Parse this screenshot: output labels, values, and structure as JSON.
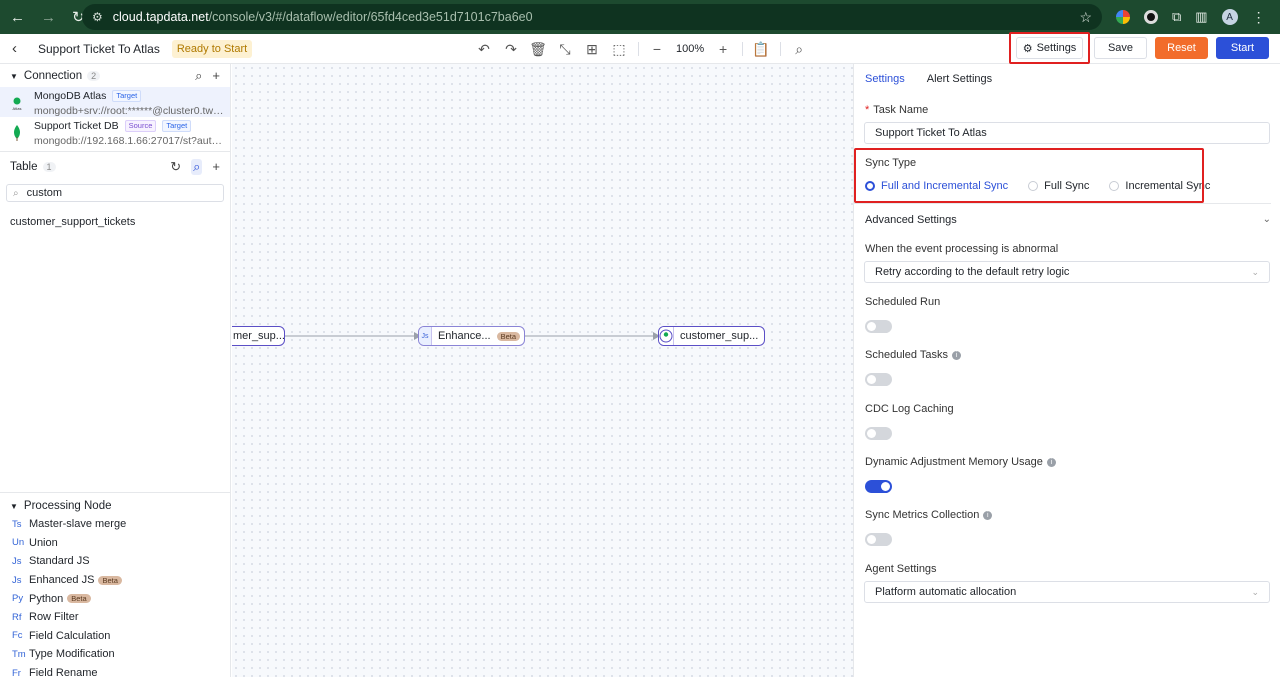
{
  "browser": {
    "url_host": "cloud.tapdata.net",
    "url_path": "/console/v3/#/dataflow/editor/65fd4ced3e51d7101c7ba6e0",
    "avatar_letter": "A"
  },
  "toolbar": {
    "task_name": "Support Ticket To Atlas",
    "status": "Ready to Start",
    "zoom": "100%",
    "settings_label": "Settings",
    "save_label": "Save",
    "reset_label": "Reset",
    "start_label": "Start",
    "colors": {
      "reset": "#f26c2b",
      "start": "#2c50d8",
      "highlight": "#e02020"
    }
  },
  "sidebar": {
    "connection_title": "Connection",
    "connection_count": "2",
    "connections": [
      {
        "name": "MongoDB Atlas",
        "tags": [
          "Target"
        ],
        "uri": "mongodb+srv://root:******@cluster0.twru..."
      },
      {
        "name": "Support Ticket DB",
        "tags": [
          "Source",
          "Target"
        ],
        "uri": "mongodb://192.168.1.66:27017/st?authSou..."
      }
    ],
    "table_title": "Table",
    "table_count": "1",
    "table_search": "custom",
    "tables": [
      "customer_support_tickets"
    ],
    "processing_title": "Processing Node",
    "processing_nodes": [
      {
        "abbr": "Ts",
        "label": "Master-slave merge"
      },
      {
        "abbr": "Un",
        "label": "Union"
      },
      {
        "abbr": "Js",
        "label": "Standard JS"
      },
      {
        "abbr": "Js",
        "label": "Enhanced JS",
        "beta": "Beta"
      },
      {
        "abbr": "Py",
        "label": "Python",
        "beta": "Beta"
      },
      {
        "abbr": "Rf",
        "label": "Row Filter"
      },
      {
        "abbr": "Fc",
        "label": "Field Calculation"
      },
      {
        "abbr": "Tm",
        "label": "Type Modification"
      },
      {
        "abbr": "Fr",
        "label": "Field Rename"
      }
    ]
  },
  "canvas": {
    "nodes": [
      {
        "label": "mer_sup..."
      },
      {
        "icon": "Js",
        "label": "Enhance...",
        "beta": "Beta"
      },
      {
        "label": "customer_sup..."
      }
    ]
  },
  "settings": {
    "tabs": [
      "Settings",
      "Alert Settings"
    ],
    "task_name_label": "Task Name",
    "task_name_value": "Support Ticket To Atlas",
    "sync_type_label": "Sync Type",
    "sync_options": [
      "Full and Incremental Sync",
      "Full Sync",
      "Incremental Sync"
    ],
    "sync_selected": "Full and Incremental Sync",
    "advanced_label": "Advanced Settings",
    "abnormal_label": "When the event processing is abnormal",
    "abnormal_value": "Retry according to the default retry logic",
    "scheduled_run_label": "Scheduled Run",
    "scheduled_run_on": false,
    "scheduled_tasks_label": "Scheduled Tasks",
    "scheduled_tasks_on": false,
    "cdc_label": "CDC Log Caching",
    "cdc_on": false,
    "dynamic_label": "Dynamic Adjustment Memory Usage",
    "dynamic_on": true,
    "metrics_label": "Sync Metrics Collection",
    "metrics_on": false,
    "agent_label": "Agent Settings",
    "agent_value": "Platform automatic allocation"
  }
}
